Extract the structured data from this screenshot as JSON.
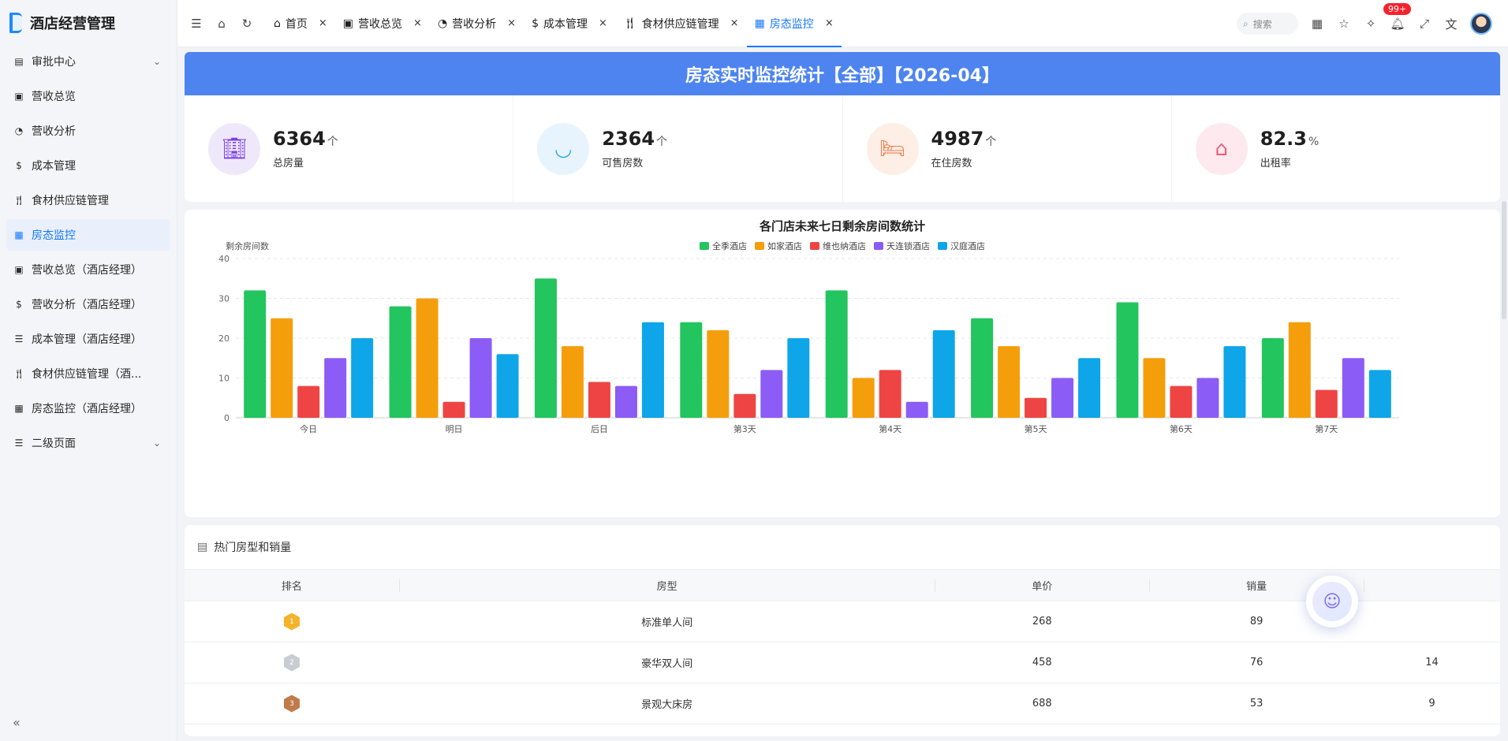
{
  "app": {
    "title": "酒店经营管理"
  },
  "sidebar": {
    "items": [
      {
        "label": "审批中心",
        "icon": "approval-icon",
        "expandable": true
      },
      {
        "label": "营收总览",
        "icon": "revenue-overview-icon"
      },
      {
        "label": "营收分析",
        "icon": "analysis-icon"
      },
      {
        "label": "成本管理",
        "icon": "dollar-icon"
      },
      {
        "label": "食材供应链管理",
        "icon": "utensils-icon"
      },
      {
        "label": "房态监控",
        "icon": "calendar-icon",
        "active": true
      },
      {
        "label": "营收总览（酒店经理）",
        "icon": "revenue-overview-icon"
      },
      {
        "label": "营收分析（酒店经理）",
        "icon": "dollar-icon"
      },
      {
        "label": "成本管理（酒店经理）",
        "icon": "list-icon"
      },
      {
        "label": "食材供应链管理（酒...",
        "icon": "utensils-icon"
      },
      {
        "label": "房态监控（酒店经理）",
        "icon": "calendar-icon"
      },
      {
        "label": "二级页面",
        "icon": "list-icon",
        "expandable": true
      }
    ]
  },
  "tabs": [
    {
      "label": "首页",
      "icon": "home-icon"
    },
    {
      "label": "营收总览",
      "icon": "revenue-overview-icon"
    },
    {
      "label": "营收分析",
      "icon": "analysis-icon"
    },
    {
      "label": "成本管理",
      "icon": "dollar-icon"
    },
    {
      "label": "食材供应链管理",
      "icon": "utensils-icon"
    },
    {
      "label": "房态监控",
      "icon": "calendar-icon",
      "active": true
    }
  ],
  "topbar": {
    "search_label": "搜索",
    "notifications_badge": "99+"
  },
  "banner": {
    "title": "房态实时监控统计【全部】【2026-04】"
  },
  "stats": [
    {
      "value": "6364",
      "unit": "个",
      "label": "总房量",
      "icon": "building-icon",
      "color": "#7b3fe4",
      "bg": "#efe8fb"
    },
    {
      "value": "2364",
      "unit": "个",
      "label": "可售房数",
      "icon": "shopping-bag-icon",
      "color": "#3aa7f0",
      "bg": "#e8f4fd"
    },
    {
      "value": "4987",
      "unit": "个",
      "label": "在住房数",
      "icon": "bed-icon",
      "color": "#f07e4b",
      "bg": "#fdeee6"
    },
    {
      "value": "82.3",
      "unit": "%",
      "label": "出租率",
      "icon": "home-location-icon",
      "color": "#ee5c7c",
      "bg": "#fde9ee"
    }
  ],
  "chart_data": {
    "type": "bar",
    "title": "各门店未来七日剩余房间数统计",
    "ylabel": "剩余房间数",
    "xlabel": "",
    "ylim": [
      0,
      40
    ],
    "yticks": [
      0,
      10,
      20,
      30,
      40
    ],
    "grid": true,
    "legend_position": "top-center",
    "categories": [
      "今日",
      "明日",
      "后日",
      "第3天",
      "第4天",
      "第5天",
      "第6天",
      "第7天"
    ],
    "series": [
      {
        "name": "全季酒店",
        "color": "#22c55e",
        "values": [
          32,
          28,
          35,
          24,
          32,
          25,
          29,
          20
        ]
      },
      {
        "name": "如家酒店",
        "color": "#f59e0b",
        "values": [
          25,
          30,
          18,
          22,
          10,
          18,
          15,
          24
        ]
      },
      {
        "name": "维也纳酒店",
        "color": "#ef4444",
        "values": [
          8,
          4,
          9,
          6,
          12,
          5,
          8,
          7
        ]
      },
      {
        "name": "天连锁酒店",
        "color": "#8b5cf6",
        "values": [
          15,
          20,
          8,
          12,
          4,
          10,
          10,
          15
        ]
      },
      {
        "name": "汉庭酒店",
        "color": "#0ea5e9",
        "values": [
          20,
          16,
          24,
          20,
          22,
          15,
          18,
          12
        ]
      }
    ]
  },
  "table": {
    "title": "热门房型和销量",
    "columns": [
      "排名",
      "房型",
      "单价",
      "销量",
      ""
    ],
    "rows": [
      {
        "rank": "1",
        "type": "标准单人间",
        "price": "268",
        "sales": "89",
        "extra": ""
      },
      {
        "rank": "2",
        "type": "豪华双人间",
        "price": "458",
        "sales": "76",
        "extra": "14"
      },
      {
        "rank": "3",
        "type": "景观大床房",
        "price": "688",
        "sales": "53",
        "extra": "9"
      }
    ]
  }
}
